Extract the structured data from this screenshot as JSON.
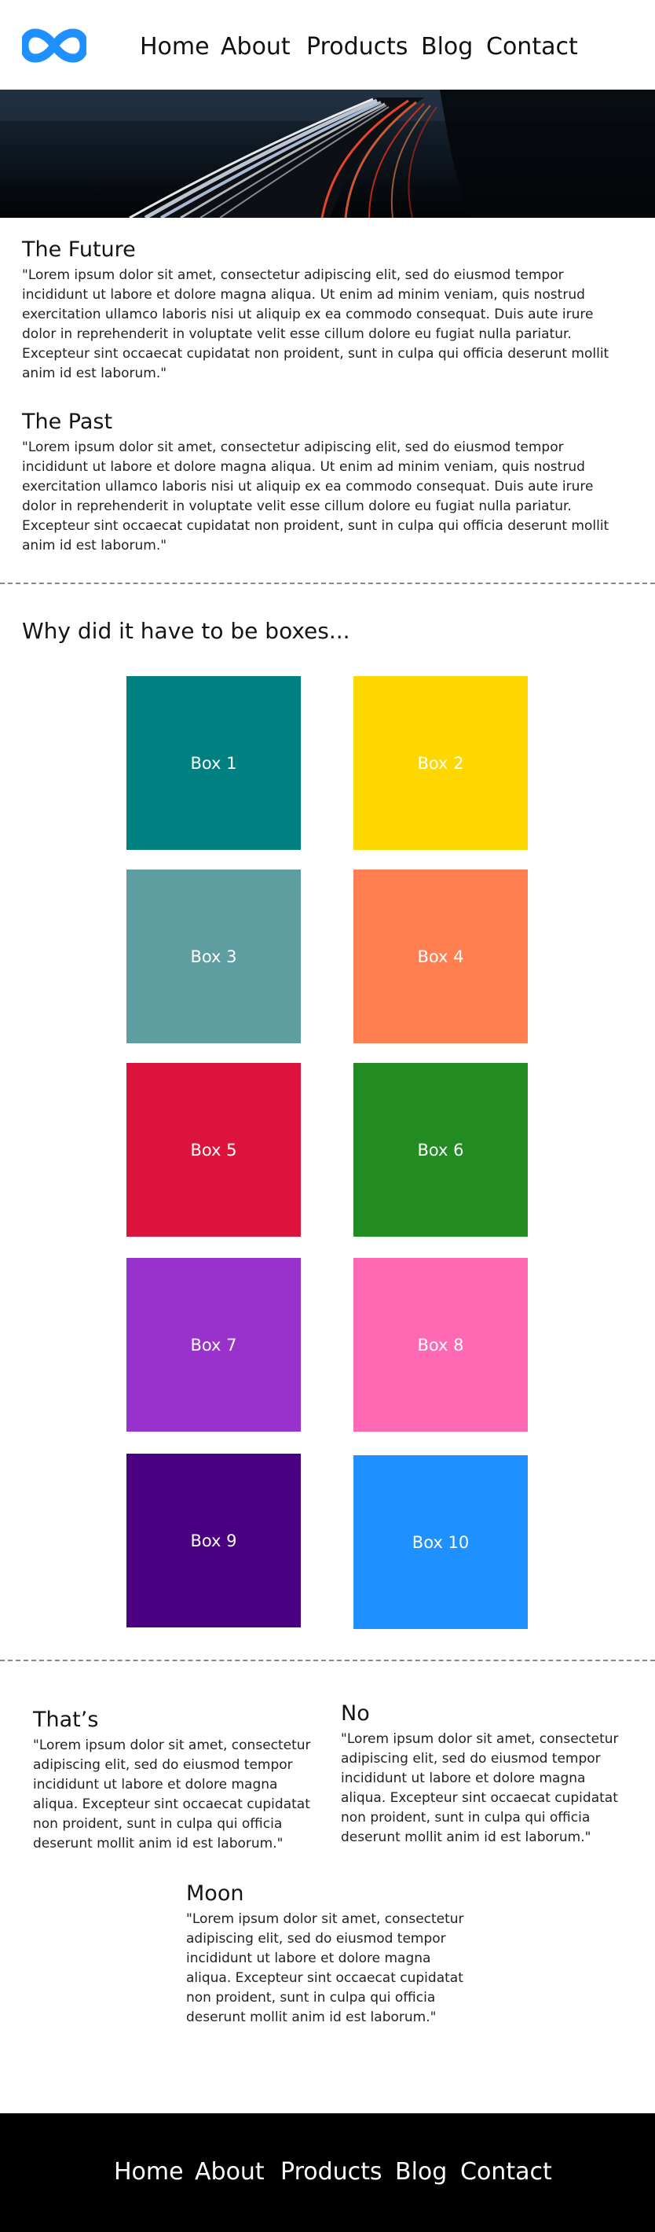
{
  "nav": {
    "links": [
      "Home",
      "About",
      "Products",
      "Blog",
      "Contact"
    ]
  },
  "logo": {
    "icon": "infinity-icon",
    "color": "#1e90ff"
  },
  "hero": {
    "description": "light-trails-image"
  },
  "articles": [
    {
      "title": "The Future",
      "body": "\"Lorem ipsum dolor sit amet, consectetur adipiscing elit, sed do eiusmod tempor incididunt ut labore et dolore magna aliqua. Ut enim ad minim veniam, quis nostrud exercitation ullamco laboris nisi ut aliquip ex ea commodo consequat. Duis aute irure dolor in reprehenderit in voluptate velit esse cillum dolore eu fugiat nulla pariatur. Excepteur sint occaecat cupidatat non proident, sunt in culpa qui officia deserunt mollit anim id est laborum.\""
    },
    {
      "title": "The Past",
      "body": "\"Lorem ipsum dolor sit amet, consectetur adipiscing elit, sed do eiusmod tempor incididunt ut labore et dolore magna aliqua. Ut enim ad minim veniam, quis nostrud exercitation ullamco laboris nisi ut aliquip ex ea commodo consequat. Duis aute irure dolor in reprehenderit in voluptate velit esse cillum dolore eu fugiat nulla pariatur. Excepteur sint occaecat cupidatat non proident, sunt in culpa qui officia deserunt mollit anim id est laborum.\""
    }
  ],
  "boxes": {
    "heading": "Why did it have to be boxes...",
    "items": [
      {
        "label": "Box 1",
        "color": "#008080"
      },
      {
        "label": "Box 2",
        "color": "#ffd700"
      },
      {
        "label": "Box 3",
        "color": "#5f9ea0"
      },
      {
        "label": "Box 4",
        "color": "#ff7f50"
      },
      {
        "label": "Box 5",
        "color": "#dc143c"
      },
      {
        "label": "Box 6",
        "color": "#228b22"
      },
      {
        "label": "Box 7",
        "color": "#9932cc"
      },
      {
        "label": "Box 8",
        "color": "#ff69b4"
      },
      {
        "label": "Box 9",
        "color": "#4b0082"
      },
      {
        "label": "Box 10",
        "color": "#1e90ff"
      }
    ]
  },
  "columns": [
    {
      "title": "That’s",
      "body": "\"Lorem ipsum dolor sit amet, consectetur adipiscing elit, sed do eiusmod tempor incididunt ut labore et dolore magna aliqua. Excepteur sint occaecat cupidatat non proident, sunt in culpa qui officia deserunt mollit anim id est laborum.\""
    },
    {
      "title": "No",
      "body": "\"Lorem ipsum dolor sit amet, consectetur adipiscing elit, sed do eiusmod tempor incididunt ut labore et dolore magna aliqua. Excepteur sint occaecat cupidatat non proident, sunt in culpa qui officia deserunt mollit anim id est laborum.\""
    },
    {
      "title": "Moon",
      "body": "\"Lorem ipsum dolor sit amet, consectetur adipiscing elit, sed do eiusmod tempor incididunt ut labore et dolore magna aliqua. Excepteur sint occaecat cupidatat non proident, sunt in culpa qui officia deserunt mollit anim id est laborum.\""
    }
  ],
  "footer": {
    "links": [
      "Home",
      "About",
      "Products",
      "Blog",
      "Contact"
    ]
  }
}
